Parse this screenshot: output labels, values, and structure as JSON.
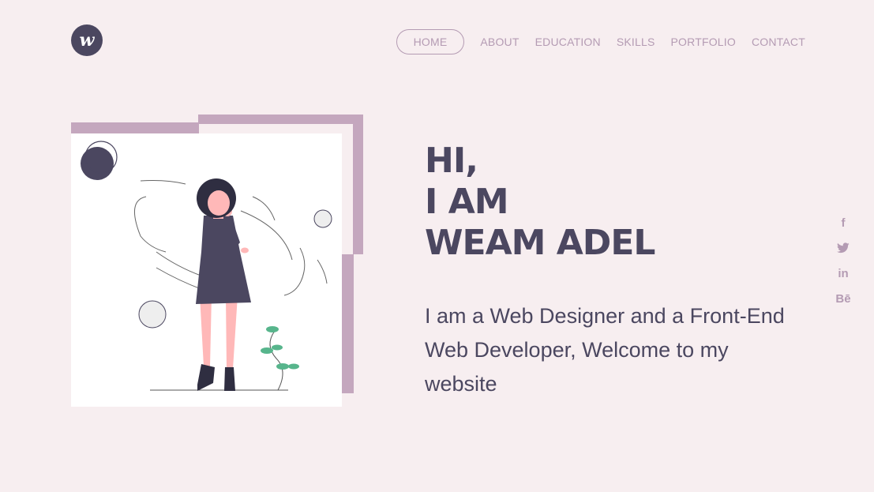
{
  "header": {
    "logo_letter": "w",
    "nav": [
      {
        "label": "HOME",
        "active": true
      },
      {
        "label": "ABOUT",
        "active": false
      },
      {
        "label": "EDUCATION",
        "active": false
      },
      {
        "label": "SKILLS",
        "active": false
      },
      {
        "label": "PORTFOLIO",
        "active": false
      },
      {
        "label": "CONTACT",
        "active": false
      }
    ]
  },
  "hero": {
    "title_lines": [
      "HI,",
      "I AM",
      "WEAM ADEL"
    ],
    "description": "I am a Web Designer and a Front-End Web Developer, Welcome to my website"
  },
  "social": [
    {
      "label": "f",
      "icon": "facebook-icon"
    },
    {
      "label": "",
      "icon": "twitter-icon"
    },
    {
      "label": "in",
      "icon": "linkedin-icon"
    },
    {
      "label": "Bē",
      "icon": "behance-icon"
    }
  ],
  "colors": {
    "background": "#f7eef0",
    "primary": "#4b4760",
    "accent": "#c4a7be",
    "muted": "#b49bb3"
  }
}
